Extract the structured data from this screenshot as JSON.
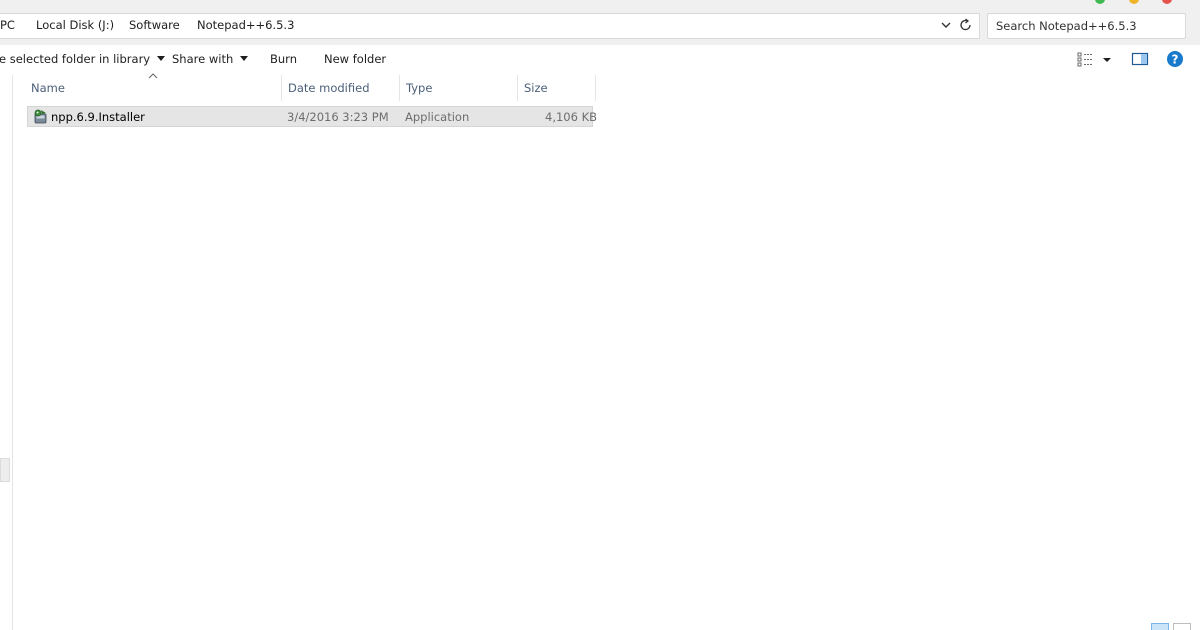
{
  "address_bar": {
    "breadcrumbs": [
      "PC",
      "Local Disk (J:)",
      "Software",
      "Notepad++6.5.3"
    ],
    "search_placeholder": "Search Notepad++6.5.3",
    "dropdown_icon": "chevron-down-icon",
    "refresh_icon": "refresh-icon"
  },
  "command_bar": {
    "include_in_library": "e selected folder in library",
    "share_with": "Share with",
    "burn": "Burn",
    "new_folder": "New folder",
    "view_options_icon": "view-options-icon",
    "preview_pane_icon": "preview-pane-icon",
    "help_icon": "help-icon"
  },
  "columns": {
    "name": "Name",
    "date_modified": "Date modified",
    "type": "Type",
    "size": "Size"
  },
  "files": [
    {
      "name": "npp.6.9.Installer",
      "date_modified": "3/4/2016 3:23 PM",
      "type": "Application",
      "size": "4,106 KB",
      "icon": "installer-icon"
    }
  ],
  "colors": {
    "accent": "#1979ca",
    "selection": "#e5e5e5",
    "header_text": "#4c607a",
    "window_green": "#3fb950",
    "window_yellow": "#f0b429",
    "window_red": "#e5534b"
  }
}
